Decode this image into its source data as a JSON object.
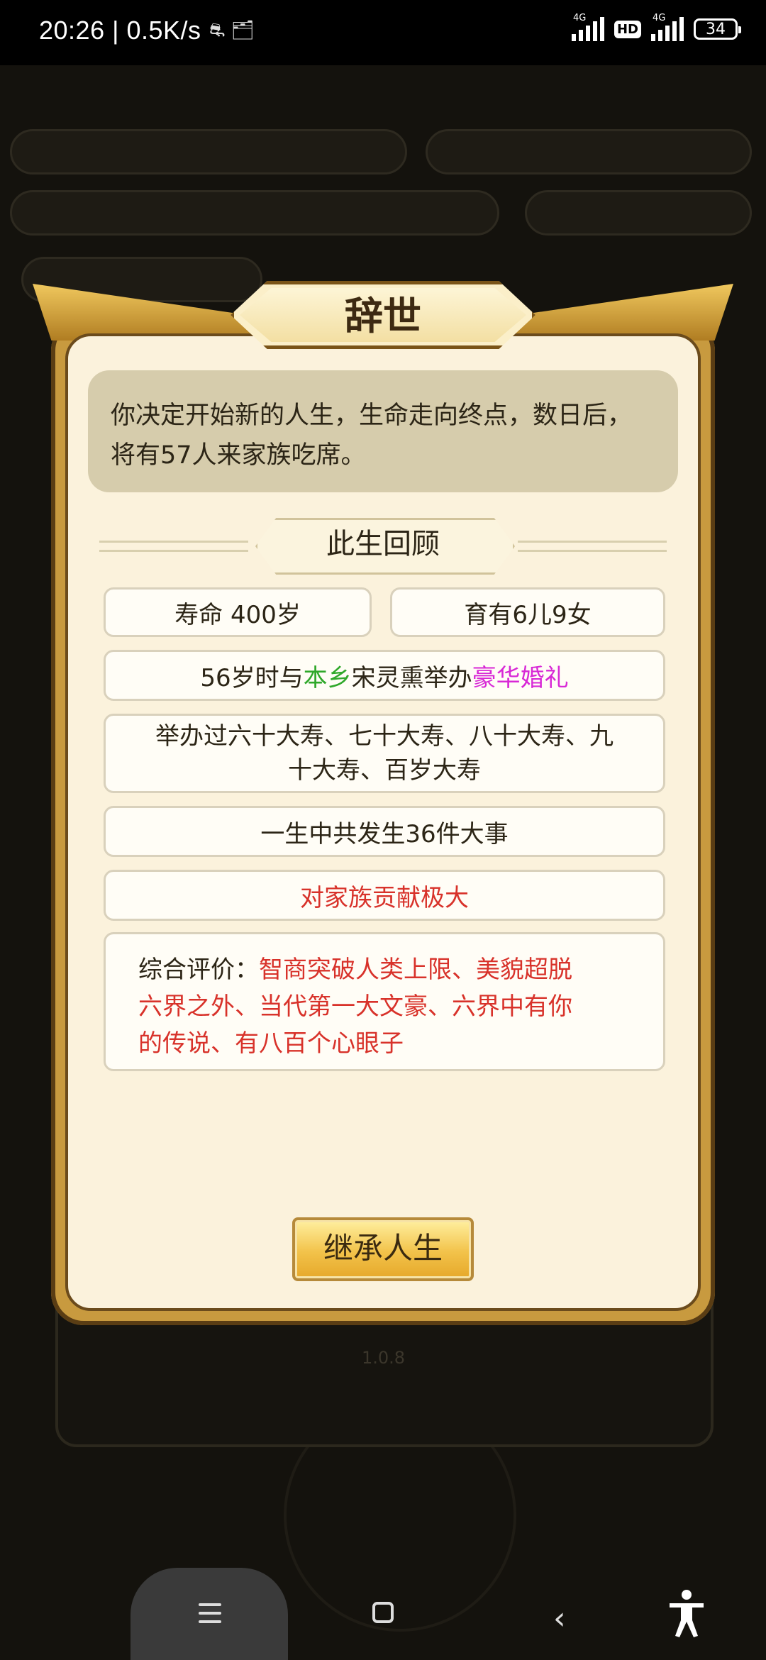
{
  "status_bar": {
    "time": "20:26",
    "net_speed": "| 0.5K/s",
    "notif_icons": "⛐ 🗂",
    "signal1_tag": "4G",
    "hd_label": "HD",
    "signal2_tag": "4G",
    "battery": "34"
  },
  "background": {
    "version": "1.0.8"
  },
  "dialog": {
    "title": "辞世",
    "message_line1": "你决定开始新的人生，生命走向终点，数日后，",
    "message_line2": "将有57人来家族吃席。",
    "section_title": "此生回顾",
    "lifespan": "寿命 400岁",
    "children": "育有6儿9女",
    "marriage": {
      "prefix": "56岁时与",
      "place": "本乡",
      "middle": "宋灵熏举办",
      "wedding": "豪华婚礼"
    },
    "birthdays_line1": "举办过六十大寿、七十大寿、八十大寿、九",
    "birthdays_line2": "十大寿、百岁大寿",
    "events": "一生中共发生36件大事",
    "contribution": "对家族贡献极大",
    "evaluation_label": "综合评价：",
    "evaluation_line1": "智商突破人类上限、美貌超脱",
    "evaluation_line2": "六界之外、当代第一大文豪、六界中有你",
    "evaluation_line3": "的传说、有八百个心眼子",
    "button": "继承人生"
  },
  "colors": {
    "green_text": "#2fa82a",
    "pink_text": "#d828d6",
    "red_text": "#d8322a",
    "dialog_bg": "#fbf2dc",
    "frame_gold": "#c89a3f"
  }
}
